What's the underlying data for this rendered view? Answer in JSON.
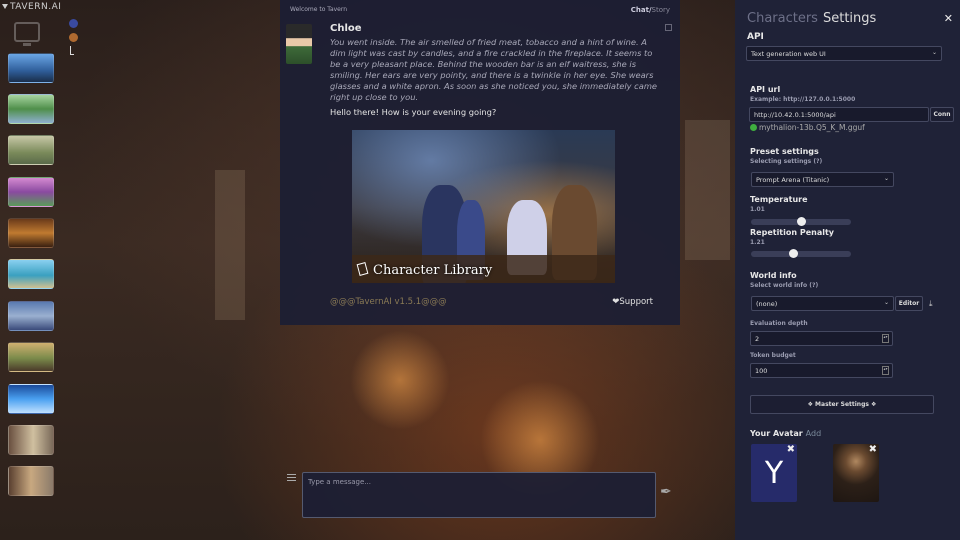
{
  "app": {
    "logo": "TAVERN.AI"
  },
  "colors": {
    "accent_green": "#3fae3f",
    "panel_bg": "#1f2237",
    "chat_bg": "#1c1e34"
  },
  "chat": {
    "header_left": "Welcome to Tavern",
    "mode_active": "Chat",
    "mode_sep": "/",
    "mode_inactive": "Story",
    "message": {
      "name": "Chloe",
      "narration": "You went inside. The air smelled of fried meat, tobacco and a hint of wine. A dim light was cast by candles, and a fire crackled in the fireplace. It seems to be a very pleasant place. Behind the wooden bar is an elf waitress, she is smiling. Her ears are very pointy, and there is a twinkle in her eye. She wears glasses and a white apron. As soon as she noticed you, she immediately came right up close to you.",
      "greeting": "Hello there! How is your evening going?",
      "image_caption": "Character Library"
    },
    "version": "@@@TavernAI v1.5.1@@@",
    "support": "Support",
    "input_placeholder": "Type a message..."
  },
  "settings": {
    "tab_characters": "Characters",
    "tab_settings": "Settings",
    "api_label": "API",
    "api_select": "Text generation web UI",
    "api_url_label": "API url",
    "api_url_example": "Example: http://127.0.0.1:5000",
    "api_url_value": "http://10.42.0.1:5000/api",
    "connect_button": "Conn",
    "model_status": "mythalion-13b.Q5_K_M.gguf",
    "preset_label": "Preset settings",
    "preset_sub": "Selecting settings (?)",
    "preset_value": "Prompt Arena (Titanic)",
    "temperature_label": "Temperature",
    "temperature_value": "1.01",
    "temperature_fraction": 0.5,
    "rep_penalty_label": "Repetition Penalty",
    "rep_penalty_value": "1.21",
    "rep_penalty_fraction": 0.42,
    "world_info_label": "World info",
    "world_info_sub": "Select world info (?)",
    "world_info_value": "(none)",
    "editor_button": "Editor",
    "eval_depth_label": "Evaluation depth",
    "eval_depth_value": "2",
    "token_budget_label": "Token budget",
    "token_budget_value": "100",
    "master_settings": "❖ Master Settings ❖",
    "your_avatar_label": "Your Avatar",
    "add_link": "Add",
    "avatar_letter": "Y"
  }
}
